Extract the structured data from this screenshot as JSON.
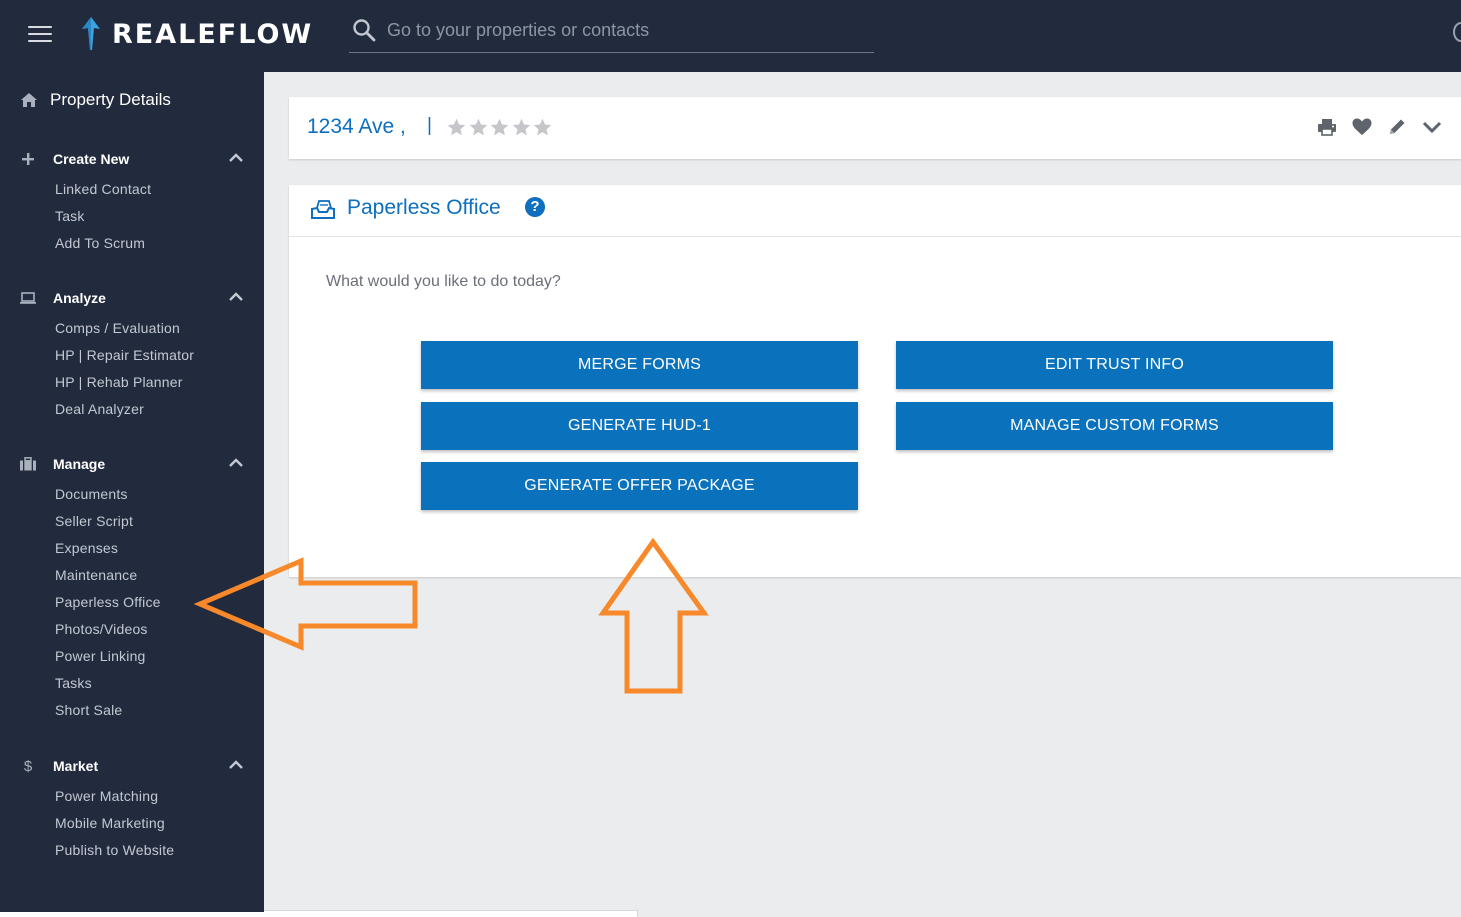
{
  "header": {
    "brand": "REALEFLOW",
    "search_placeholder": "Go to your properties or contacts",
    "search_value": ""
  },
  "sidebar": {
    "title": "Property Details",
    "sections": [
      {
        "label": "Create New",
        "icon": "plus-icon",
        "items": [
          "Linked Contact",
          "Task",
          "Add To Scrum"
        ]
      },
      {
        "label": "Analyze",
        "icon": "laptop-icon",
        "items": [
          "Comps / Evaluation",
          "HP | Repair Estimator",
          "HP | Rehab Planner",
          "Deal Analyzer"
        ]
      },
      {
        "label": "Manage",
        "icon": "briefcase-icon",
        "items": [
          "Documents",
          "Seller Script",
          "Expenses",
          "Maintenance",
          "Paperless Office",
          "Photos/Videos",
          "Power Linking",
          "Tasks",
          "Short Sale"
        ]
      },
      {
        "label": "Market",
        "icon": "dollar-icon",
        "items": [
          "Power Matching",
          "Mobile Marketing",
          "Publish to Website"
        ]
      }
    ]
  },
  "property": {
    "address": "1234 Ave ,",
    "separator": "|",
    "rating": 0,
    "rating_max": 5
  },
  "paperless": {
    "title": "Paperless Office",
    "question": "What would you like to do today?",
    "buttons": {
      "merge_forms": "MERGE FORMS",
      "edit_trust_info": "EDIT TRUST INFO",
      "generate_hud1": "GENERATE HUD-1",
      "manage_custom_forms": "MANAGE CUSTOM FORMS",
      "generate_offer_package": "GENERATE OFFER PACKAGE"
    }
  },
  "colors": {
    "nav_bg": "#222a3d",
    "accent_blue": "#0a72bc",
    "annotation_orange": "#f7892b"
  }
}
